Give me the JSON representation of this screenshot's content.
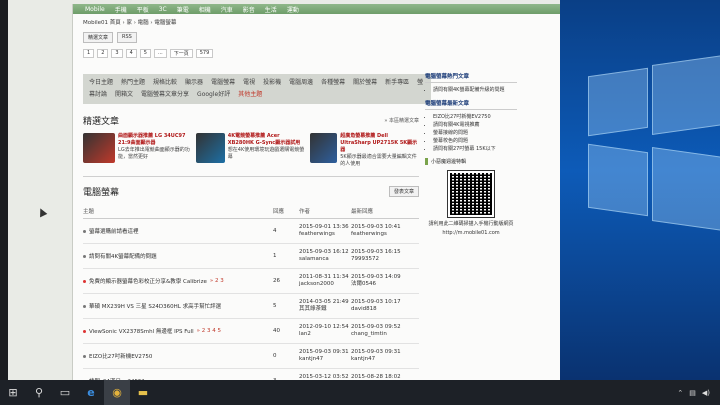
{
  "menu": [
    "Mobile",
    "手機",
    "平板",
    "3C",
    "筆電",
    "相機",
    "汽車",
    "影音",
    "生活",
    "運動"
  ],
  "breadcrumb": "Mobile01 首頁 › 家 › 電腦 › 電腦螢幕",
  "toolbar": {
    "all_label": "精選文章",
    "rss_label": "RSS"
  },
  "pager": [
    "1",
    "2",
    "3",
    "4",
    "5",
    "...",
    "下一頁",
    "579"
  ],
  "subnav": [
    {
      "label": "今日主題",
      "red": false
    },
    {
      "label": "熱門主題",
      "red": false
    },
    {
      "label": "規格比較",
      "red": false
    },
    {
      "label": "顯示器",
      "red": false
    },
    {
      "label": "電腦螢幕",
      "red": false
    },
    {
      "label": "電視",
      "red": false
    },
    {
      "label": "投影機",
      "red": false
    },
    {
      "label": "電腦周邊",
      "red": false
    },
    {
      "label": "各種螢幕",
      "red": false
    },
    {
      "label": "關於螢幕",
      "red": false
    },
    {
      "label": "新手專區",
      "red": false
    },
    {
      "label": "螢幕討論",
      "red": false
    },
    {
      "label": "開箱文",
      "red": false
    },
    {
      "label": "電腦螢幕文章分享",
      "red": false
    },
    {
      "label": "Google好評",
      "red": false
    },
    {
      "label": "其他主題",
      "red": true
    }
  ],
  "featured": {
    "title": "精選文章",
    "more": "» 本區精選文章",
    "items": [
      {
        "title": "曲面顯示器推薦 LG 34UC97 21:9曲面顯示器",
        "desc": "LG去年推出電競曲面顯示器的功能，當然更好",
        "color": "#c0392b"
      },
      {
        "title": "4K電競螢幕推薦 Acer XB280HK G-Sync顯示器試用",
        "desc": "想在4K使用環境玩遊戲選購電競螢幕",
        "color": "#1d6fa5"
      },
      {
        "title": "超廣角螢幕推薦 Dell UltraSharp UP2715K 5K顯示器",
        "desc": "5K顯示器最適合需要大量編輯文件的人使用",
        "color": "#2e5f9e"
      }
    ]
  },
  "board": {
    "title": "電腦螢幕",
    "new_post": "發表文章",
    "cols": {
      "topic": "主題",
      "replies": "回應",
      "author": "作者",
      "last": "最新回應"
    },
    "rows": [
      {
        "topic": "螢幕選購前請看這裡",
        "replies": "4",
        "author_date": "2015-09-01 13:36",
        "author": "featherwings",
        "last_date": "2015-09-03 10:41",
        "last_user": "featherwings",
        "hot": false,
        "pages": ""
      },
      {
        "topic": "請問有關4K螢幕配備的問題",
        "replies": "1",
        "author_date": "2015-09-03 16:12",
        "author": "salamanca",
        "last_date": "2015-09-03 16:15",
        "last_user": "79993572",
        "hot": false,
        "pages": ""
      },
      {
        "topic": "免費的顯示器螢幕色彩校正分享&教學 Calibrize",
        "replies": "26",
        "author_date": "2011-08-31 11:34",
        "author": "jackson2000",
        "last_date": "2015-09-03 14:09",
        "last_user": "法爾0546",
        "hot": true,
        "pages": "» 2 3"
      },
      {
        "topic": "華碩 MX239H VS 三星 S24D360HL 求高手幫忙評選",
        "replies": "5",
        "author_date": "2014-03-05 21:49",
        "author": "其其綠茶鐵",
        "last_date": "2015-09-03 10:17",
        "last_user": "david818",
        "hot": false,
        "pages": ""
      },
      {
        "topic": "ViewSonic VX2378Smhl 無邊框 IPS Full",
        "replies": "40",
        "author_date": "2012-09-10 12:54",
        "author": "lan2",
        "last_date": "2015-09-03 09:52",
        "last_user": "chang_timtin",
        "hot": true,
        "pages": "» 2 3 4 5"
      },
      {
        "topic": "EIZO比27吋新機EV2750",
        "replies": "0",
        "author_date": "2015-09-03 09:31",
        "author": "kantjn47",
        "last_date": "2015-09-03 09:31",
        "last_user": "kantjn47",
        "hot": false,
        "pages": ""
      },
      {
        "topic": "請問s24滿足ev2455?",
        "replies": "3",
        "author_date": "2015-03-12 03:52",
        "author": "我外帥雷",
        "last_date": "2015-08-28 18:02",
        "last_user": "tt2309",
        "hot": false,
        "pages": ""
      }
    ]
  },
  "sidebar": {
    "hot_title": "電腦螢幕熱門文章",
    "hot": [
      "請問有關4K螢幕配備升級的問題"
    ],
    "new_title": "電腦螢幕最新文章",
    "new": [
      "EIZO比27吋新機EV2750",
      "請問有關4K電視推薦",
      "螢幕接線的問題",
      "螢幕校色的問題",
      "請問有關27吋螢幕 15K以下"
    ],
    "qr_title": "小惡魔週邊特輯",
    "qr_text": "請利用此二維碼掃描入手機行動版網頁",
    "qr_url": "http://m.mobile01.com"
  },
  "taskbar": {
    "time": "",
    "colors": {
      "bar": "#1d2127",
      "accent": "#3a3f46"
    }
  },
  "colors": {
    "menu_green": "#6e9d69",
    "red_accent": "#c0392b"
  }
}
